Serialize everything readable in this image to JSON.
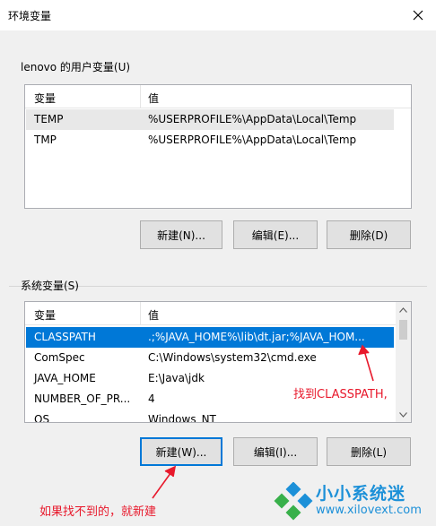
{
  "window": {
    "title": "环境变量",
    "close_glyph": "✕"
  },
  "user_vars": {
    "group_label": "lenovo 的用户变量(U)",
    "columns": [
      "变量",
      "值"
    ],
    "rows": [
      {
        "name": "TEMP",
        "value": "%USERPROFILE%\\AppData\\Local\\Temp"
      },
      {
        "name": "TMP",
        "value": "%USERPROFILE%\\AppData\\Local\\Temp"
      }
    ],
    "buttons": {
      "new": "新建(N)...",
      "edit": "编辑(E)...",
      "delete": "删除(D)"
    }
  },
  "system_vars": {
    "group_label": "系统变量(S)",
    "columns": [
      "变量",
      "值"
    ],
    "rows": [
      {
        "name": "CLASSPATH",
        "value": ".;%JAVA_HOME%\\lib\\dt.jar;%JAVA_HOM..."
      },
      {
        "name": "ComSpec",
        "value": "C:\\Windows\\system32\\cmd.exe"
      },
      {
        "name": "JAVA_HOME",
        "value": "E:\\Java\\jdk"
      },
      {
        "name": "NUMBER_OF_PR...",
        "value": "4"
      },
      {
        "name": "OS",
        "value": "Windows_NT"
      }
    ],
    "buttons": {
      "new": "新建(W)...",
      "edit": "编辑(I)...",
      "delete": "删除(L)"
    }
  },
  "annotations": {
    "find_classpath": "找到CLASSPATH,",
    "if_not_found": "如果找不到的，就新建"
  },
  "watermark": {
    "name": "小小系统迷",
    "url": "www.xilovext.com"
  },
  "colors": {
    "selection": "#0078d7",
    "annotation": "#e8192c",
    "watermark": "#1c90d8"
  }
}
